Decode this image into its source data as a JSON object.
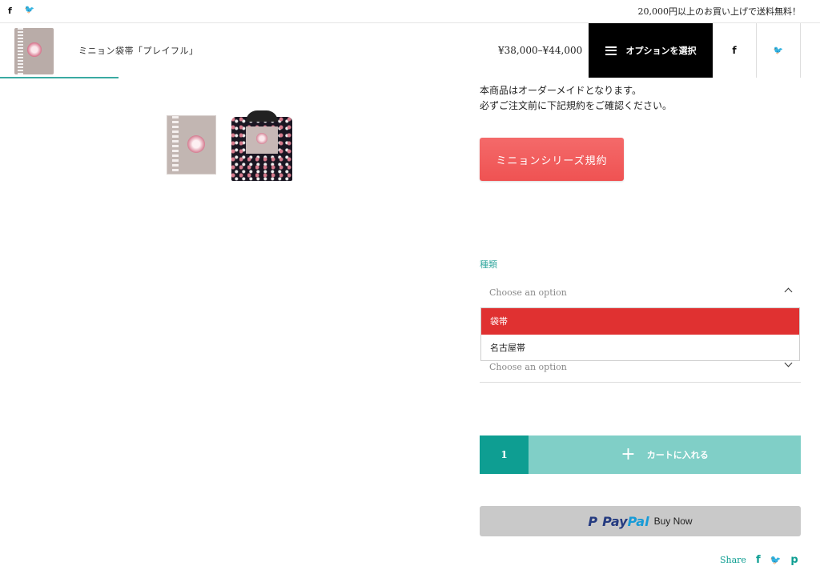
{
  "topbar": {
    "social": [
      {
        "icon": "facebook-icon",
        "glyph": "f"
      },
      {
        "icon": "twitter-icon",
        "glyph": "🐦"
      }
    ],
    "notice": "20,000円以上のお買い上げで送料無料！"
  },
  "sticky": {
    "product_name": "ミニョン袋帯「プレイフル」",
    "price": "¥38,000–¥44,000",
    "option_button": "オプションを選択",
    "share_facebook": "f",
    "share_twitter": "🐦"
  },
  "description": {
    "line1": "本商品はオーダーメイドとなります。",
    "line2": "必ずご注文前に下記規約をご確認ください。"
  },
  "rules_button": "ミニョンシリーズ規約",
  "variation": {
    "label": "種類",
    "select1_placeholder": "Choose an option",
    "options": [
      "袋帯",
      "名古屋帯"
    ],
    "selected_highlight": "袋帯",
    "select2_placeholder": "Choose an option"
  },
  "cart": {
    "quantity": "1",
    "add_label": "カートに入れる",
    "plus": "+"
  },
  "paypal": {
    "mark": "P",
    "word1": "Pay",
    "word2": "Pal",
    "buy_now": "Buy Now"
  },
  "share": {
    "label": "Share",
    "icons": [
      "facebook-icon",
      "twitter-icon",
      "pinterest-icon"
    ],
    "glyphs": [
      "f",
      "🐦",
      "p"
    ]
  },
  "colors": {
    "accent_teal": "#0e9e92",
    "light_teal": "#80cfc7",
    "rules_red": "#ef5252",
    "dropdown_highlight": "#e03131",
    "black": "#000000"
  }
}
